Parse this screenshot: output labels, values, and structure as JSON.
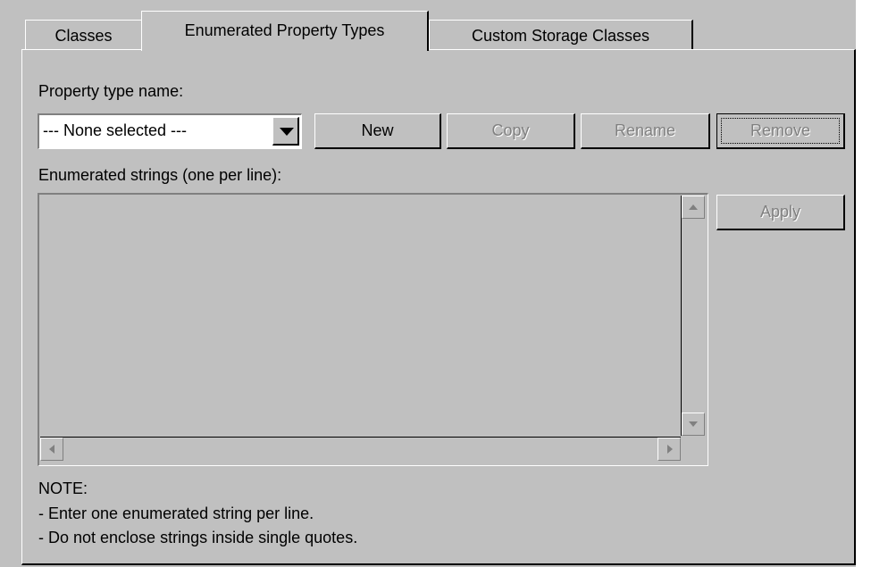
{
  "tabs": [
    {
      "label": "Classes",
      "active": false
    },
    {
      "label": "Enumerated Property Types",
      "active": true
    },
    {
      "label": "Custom Storage Classes",
      "active": false
    }
  ],
  "property_type": {
    "label": "Property type name:",
    "selected": "--- None selected ---"
  },
  "buttons": {
    "new": "New",
    "copy": "Copy",
    "rename": "Rename",
    "remove": "Remove",
    "apply": "Apply"
  },
  "enumerated_strings": {
    "label": "Enumerated strings (one per line):",
    "value": ""
  },
  "note": {
    "title": "NOTE:",
    "line1": "- Enter one enumerated string per line.",
    "line2": "- Do not enclose strings inside single quotes."
  },
  "colors": {
    "face": "#c0c0c0",
    "highlight": "#ffffff",
    "shadow": "#808080",
    "dark": "#000000",
    "disabled_text": "#808080"
  }
}
